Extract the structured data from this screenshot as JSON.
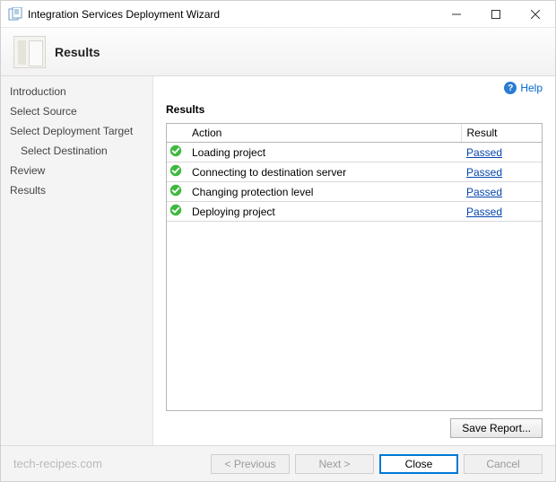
{
  "window": {
    "title": "Integration Services Deployment Wizard"
  },
  "header": {
    "title": "Results"
  },
  "help": {
    "label": "Help"
  },
  "sidebar": {
    "items": [
      {
        "label": "Introduction",
        "indent": false
      },
      {
        "label": "Select Source",
        "indent": false
      },
      {
        "label": "Select Deployment Target",
        "indent": false
      },
      {
        "label": "Select Destination",
        "indent": true
      },
      {
        "label": "Review",
        "indent": false
      },
      {
        "label": "Results",
        "indent": false
      }
    ]
  },
  "main": {
    "section_title": "Results",
    "columns": {
      "action": "Action",
      "result": "Result"
    },
    "rows": [
      {
        "action": "Loading project",
        "result": "Passed"
      },
      {
        "action": "Connecting to destination server",
        "result": "Passed"
      },
      {
        "action": "Changing protection level",
        "result": "Passed"
      },
      {
        "action": "Deploying project",
        "result": "Passed"
      }
    ],
    "save_report_label": "Save Report..."
  },
  "footer": {
    "watermark": "tech-recipes.com",
    "previous": "< Previous",
    "next": "Next >",
    "close": "Close",
    "cancel": "Cancel"
  }
}
